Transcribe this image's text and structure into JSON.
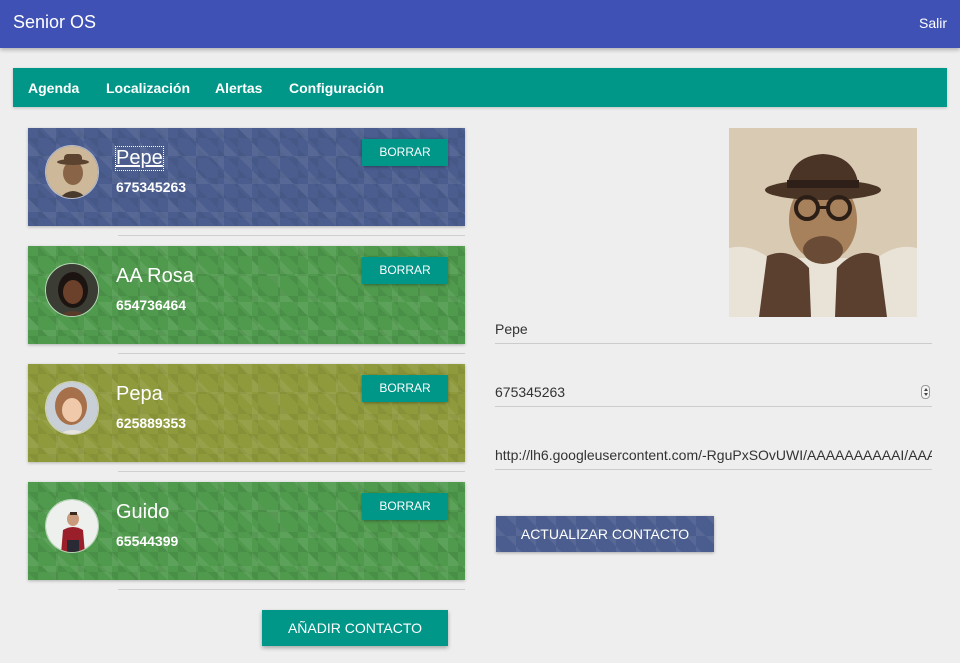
{
  "app": {
    "title": "Senior OS",
    "logout_label": "Salir"
  },
  "nav": {
    "items": [
      "Agenda",
      "Localización",
      "Alertas",
      "Configuración"
    ]
  },
  "contacts": [
    {
      "name": "Pepe",
      "phone": "675345263",
      "delete_label": "BORRAR",
      "color": "#4a5d8e"
    },
    {
      "name": "AA Rosa",
      "phone": "654736464",
      "delete_label": "BORRAR",
      "color": "#4f9a4c"
    },
    {
      "name": "Pepa",
      "phone": "625889353",
      "delete_label": "BORRAR",
      "color": "#8e9a3c"
    },
    {
      "name": "Guido",
      "phone": "65544399",
      "delete_label": "BORRAR",
      "color": "#4f9a4c"
    }
  ],
  "add_contact_label": "AÑADIR CONTACTO",
  "editor": {
    "name_value": "Pepe",
    "phone_value": "675345263",
    "photo_url_value": "http://lh6.googleusercontent.com/-RguPxSOvUWI/AAAAAAAAAAI/AAA",
    "update_label": "ACTUALIZAR CONTACTO"
  },
  "colors": {
    "primary": "#3f51b5",
    "accent": "#009688",
    "background": "#eeeeee"
  }
}
